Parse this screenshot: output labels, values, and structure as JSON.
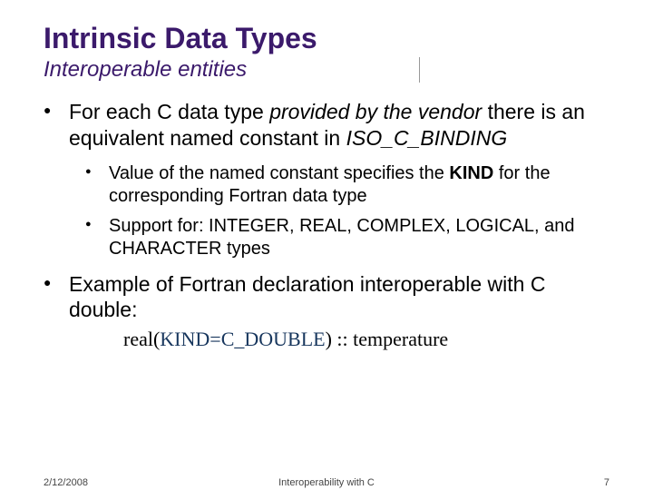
{
  "title": "Intrinsic Data Types",
  "subtitle": "Interoperable entities",
  "bullets": {
    "b1a": "For each C data type ",
    "b1b": "provided by the vendor",
    "b1c": " there is an equivalent named constant in ",
    "b1d": "ISO_C_BINDING",
    "b1_1a": "Value of the named constant specifies the ",
    "b1_1b": "KIND",
    "b1_1c": " for the corresponding Fortran data type",
    "b1_2": "Support for: INTEGER, REAL, COMPLEX, LOGICAL, and CHARACTER types",
    "b2": "Example of Fortran declaration interoperable with C double:"
  },
  "code": {
    "part1": "real(",
    "part2": "KIND=C_DOUBLE",
    "part3": ") :: temperature"
  },
  "footer": {
    "date": "2/12/2008",
    "center": "Interoperability with C",
    "page": "7"
  }
}
